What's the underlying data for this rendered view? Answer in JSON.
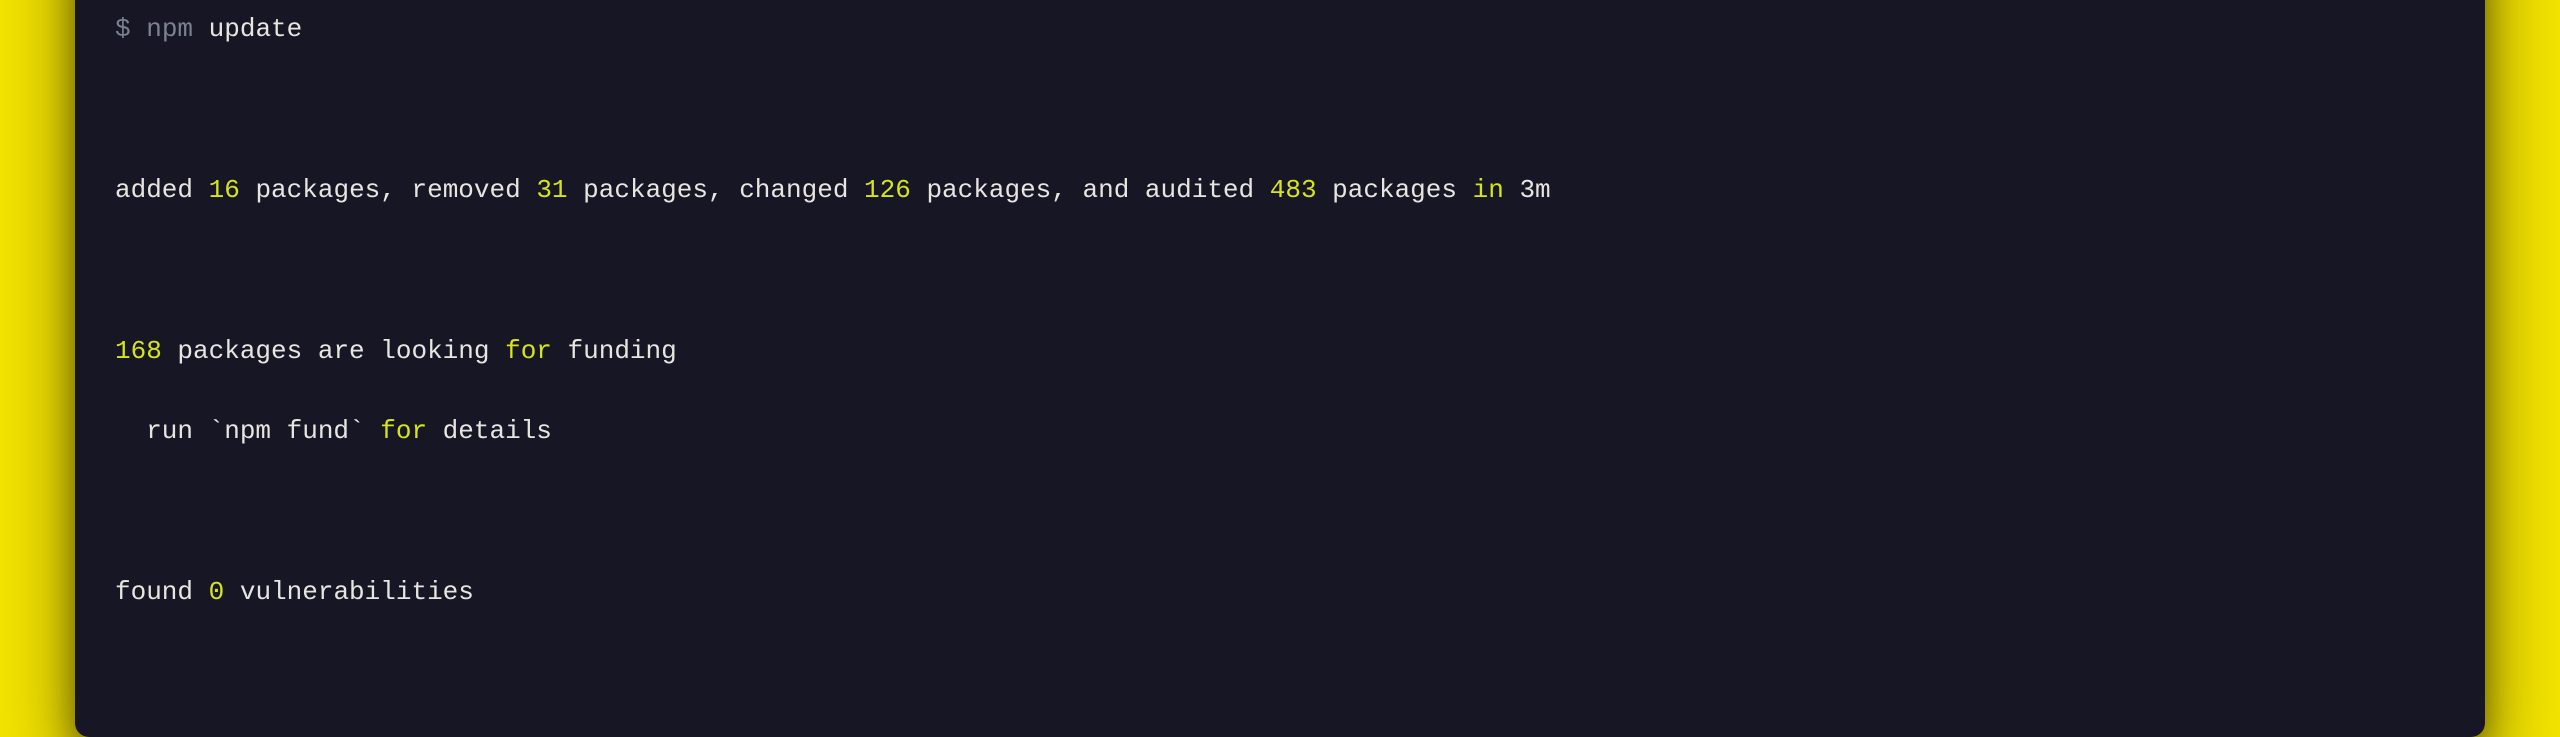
{
  "prompt": {
    "symbol": "$",
    "command": "npm",
    "arg": "update"
  },
  "summary": {
    "added_label": "added",
    "added_count": "16",
    "pkgs1": "packages,",
    "removed_label": "removed",
    "removed_count": "31",
    "pkgs2": "packages,",
    "changed_label": "changed",
    "changed_count": "126",
    "pkgs3": "packages,",
    "and_label": "and",
    "audited_label": "audited",
    "audited_count": "483",
    "pkgs4": "packages",
    "in_label": "in",
    "duration": "3m"
  },
  "funding": {
    "count": "168",
    "line1_rest": "packages are looking",
    "for_kw": "for",
    "funding_word": "funding",
    "line2_prefix": "  run `npm fund`",
    "line2_for": "for",
    "line2_rest": "details"
  },
  "vuln": {
    "found": "found",
    "count": "0",
    "rest": "vulnerabilities"
  }
}
